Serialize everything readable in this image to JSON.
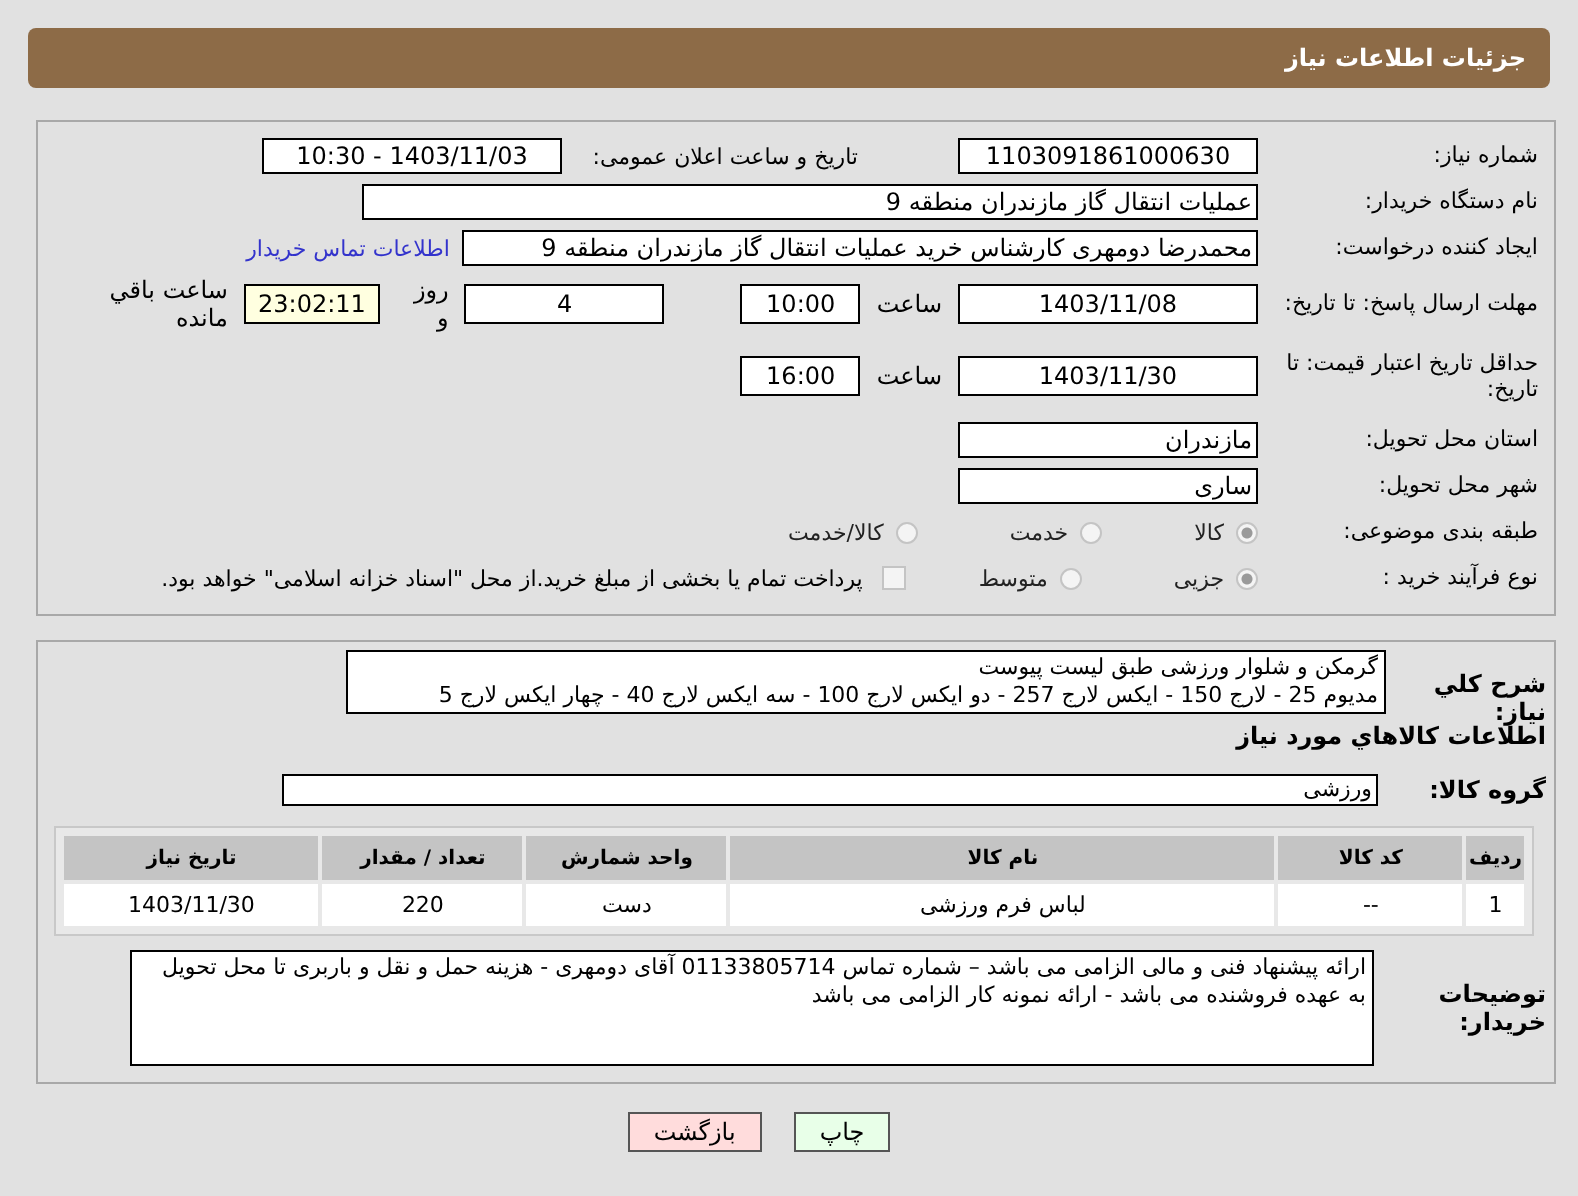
{
  "header": {
    "title": "جزئیات اطلاعات نیاز"
  },
  "need_number": {
    "label": "شماره نیاز:",
    "value": "1103091861000630"
  },
  "announcement": {
    "label": "تاریخ و ساعت اعلان عمومی:",
    "value": "1403/11/03 - 10:30"
  },
  "buyer_org": {
    "label": "نام دستگاه خریدار:",
    "value": "عملیات انتقال گاز مازندران منطقه 9"
  },
  "requester": {
    "label": "ایجاد کننده درخواست:",
    "value": "محمدرضا دومهری کارشناس خرید عملیات انتقال گاز مازندران منطقه 9",
    "link": "اطلاعات تماس خریدار"
  },
  "response_deadline": {
    "label": "مهلت ارسال پاسخ: تا تاریخ:",
    "date": "1403/11/08",
    "time_label": "ساعت",
    "time": "10:00",
    "days": "4",
    "days_label": "روز و",
    "remaining": "23:02:11",
    "remaining_label": "ساعت باقي مانده"
  },
  "price_validity": {
    "label": "حداقل تاریخ اعتبار قیمت: تا تاریخ:",
    "date": "1403/11/30",
    "time_label": "ساعت",
    "time": "16:00"
  },
  "province": {
    "label": "استان محل تحویل:",
    "value": "مازندران"
  },
  "city": {
    "label": "شهر محل تحویل:",
    "value": "ساری"
  },
  "category": {
    "label": "طبقه بندی موضوعی:",
    "options": [
      {
        "label": "کالا",
        "selected": true
      },
      {
        "label": "خدمت",
        "selected": false
      },
      {
        "label": "کالا/خدمت",
        "selected": false
      }
    ]
  },
  "purchase_type": {
    "label": "نوع فرآیند خرید :",
    "options": [
      {
        "label": "جزیی",
        "selected": true
      },
      {
        "label": "متوسط",
        "selected": false
      }
    ],
    "payment_note": {
      "label": "پرداخت تمام یا بخشی از مبلغ خرید.از محل \"اسناد خزانه اسلامی\" خواهد بود.",
      "checked": false
    }
  },
  "description": {
    "label": "شرح کلي نیاز:",
    "lines": [
      "گرمکن و شلوار ورزشی طبق لیست پیوست",
      "مدیوم 25  - لارج  150  - ایکس لارج 257  - دو ایکس لارج 100  - سه ایکس لارج  40  -  چهار ایکس لارج  5"
    ]
  },
  "goods_title": "اطلاعات کالاهاي مورد نیاز",
  "goods_group": {
    "label": "گروه کالا:",
    "value": "ورزشی"
  },
  "table": {
    "columns": [
      "ردیف",
      "کد کالا",
      "نام کالا",
      "واحد شمارش",
      "تعداد / مقدار",
      "تاریخ نیاز"
    ],
    "rows": [
      [
        "1",
        "--",
        "لباس فرم ورزشی",
        "دست",
        "220",
        "1403/11/30"
      ]
    ]
  },
  "buyer_notes": {
    "label": "توضیحات خریدار:",
    "text": "ارائه پیشنهاد فنی  و مالی الزامی می باشد – شماره تماس 01133805714 آقای دومهری  - هزینه حمل و نقل و باربری تا محل تحویل به عهده فروشنده می باشد - ارائه نمونه کار الزامی می باشد"
  },
  "buttons": [
    {
      "label": "چاپ",
      "kind": "print"
    },
    {
      "label": "بازگشت",
      "kind": "back"
    }
  ]
}
